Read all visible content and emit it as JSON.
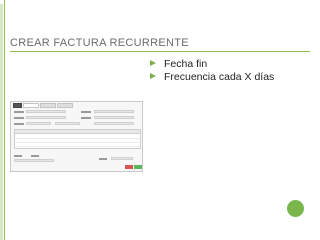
{
  "slide": {
    "title": "Crear factura recurrente",
    "bullets": [
      {
        "text": "Fecha fin"
      },
      {
        "text": "Frecuencia cada X días"
      }
    ]
  },
  "colors": {
    "accent": "#7bb04d",
    "title": "#6b6b6b",
    "text": "#222222"
  }
}
